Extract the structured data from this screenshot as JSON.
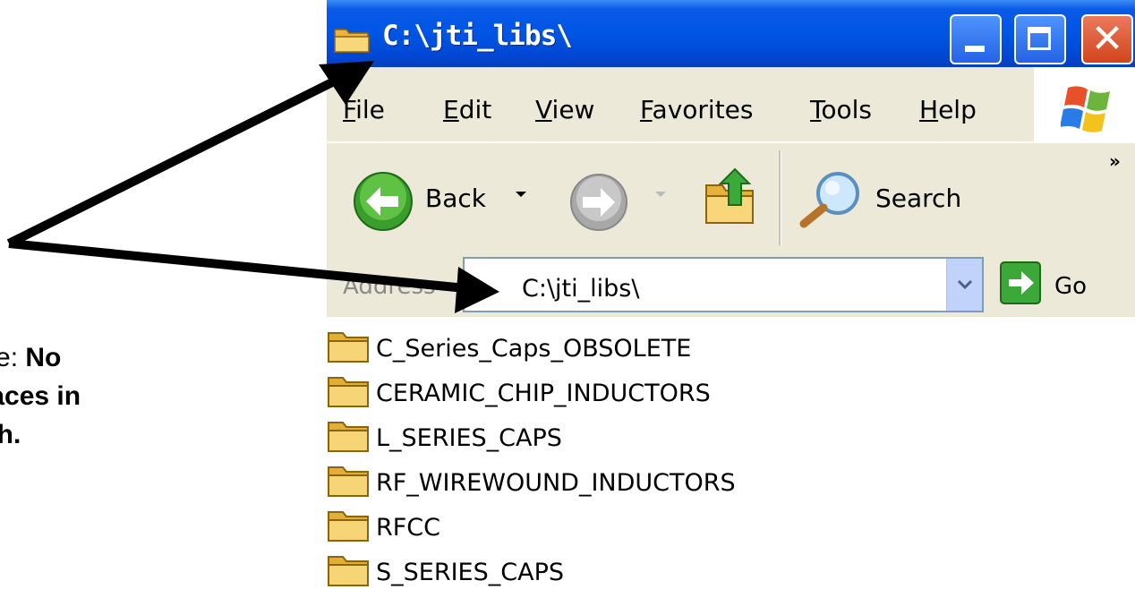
{
  "window": {
    "title": "C:\\jti_libs\\",
    "close_glyph": "✕"
  },
  "menu": {
    "items": [
      "File",
      "Edit",
      "View",
      "Favorites",
      "Tools",
      "Help"
    ]
  },
  "toolbar": {
    "back_label": "Back",
    "search_label": "Search",
    "overflow_glyph": "»"
  },
  "address": {
    "label": "Address",
    "value": "C:\\jti_libs\\",
    "go_label": "Go"
  },
  "folders": [
    "C_Series_Caps_OBSOLETE",
    "CERAMIC_CHIP_INDUCTORS",
    "L_SERIES_CAPS",
    "RF_WIREWOUND_INDUCTORS",
    "RFCC",
    "S_SERIES_CAPS"
  ],
  "note": {
    "prefix": "ote: ",
    "bold_line1": "No",
    "bold_line2": "paces in",
    "bold_line3": "ath."
  },
  "colors": {
    "titlebar": "#0055e5",
    "chrome": "#ece9d8",
    "close_button": "#d2441c",
    "folder": "#f0c75a"
  }
}
